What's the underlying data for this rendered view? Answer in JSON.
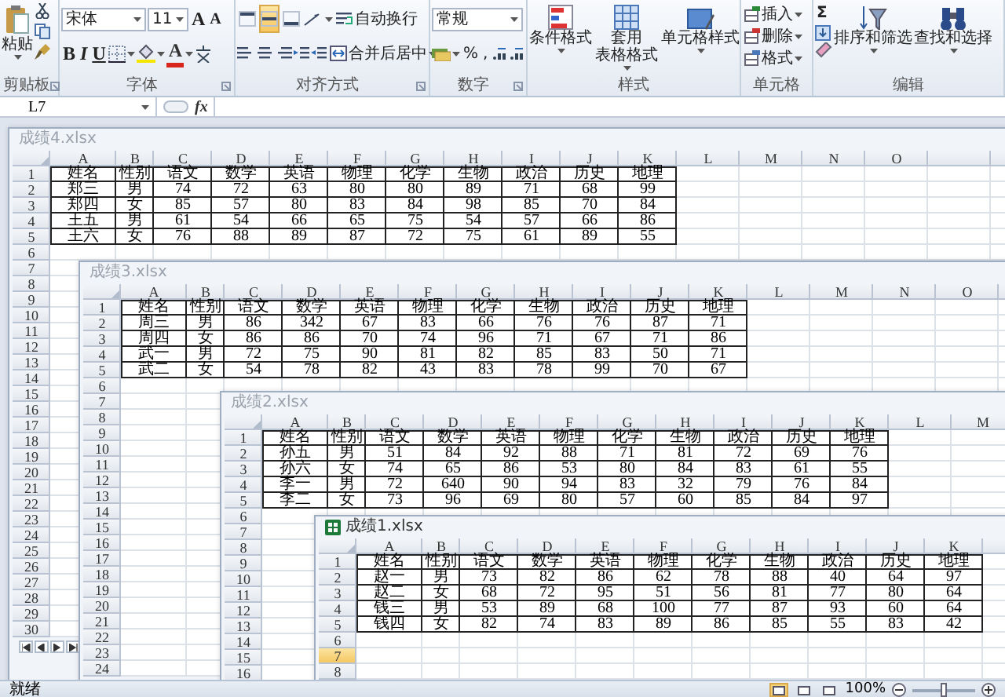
{
  "ribbon": {
    "clipboard": {
      "label": "剪贴板",
      "paste": "粘贴"
    },
    "font": {
      "label": "字体",
      "font_name": "宋体",
      "font_size": "11",
      "grow": "A",
      "shrink": "A",
      "bold": "B",
      "italic": "I",
      "underline": "U",
      "font_color": "A"
    },
    "alignment": {
      "label": "对齐方式",
      "vertical": [
        {
          "selected": false
        },
        {
          "selected": true
        },
        {
          "selected": false
        }
      ],
      "wrap": "自动换行",
      "merge": "合并后居中"
    },
    "number": {
      "label": "数字",
      "format": "常规",
      "percent": "%",
      "comma": ","
    },
    "styles": {
      "label": "样式",
      "conditional": "条件格式",
      "table": [
        "套用",
        "表格格式"
      ],
      "cell": "单元格样式"
    },
    "cells": {
      "label": "单元格",
      "insert": "插入",
      "delete": "删除",
      "format": "格式"
    },
    "editing": {
      "label": "编辑",
      "sum": "Σ",
      "sort": "排序和筛选",
      "find": "查找和选择"
    }
  },
  "formula_bar": {
    "name_box": "L7",
    "fx": "fx"
  },
  "windows": [
    {
      "title": "成绩4.xlsx",
      "active": false,
      "sheet_nav": true,
      "columns": [
        "A",
        "B",
        "C",
        "D",
        "E",
        "F",
        "G",
        "H",
        "I",
        "J",
        "K",
        "L",
        "M",
        "N",
        "O"
      ],
      "row_headers": [
        {
          "label": "1",
          "selected": false
        },
        {
          "label": "2",
          "selected": false
        },
        {
          "label": "3",
          "selected": false
        },
        {
          "label": "4",
          "selected": false
        },
        {
          "label": "5",
          "selected": false
        },
        {
          "label": "6",
          "selected": false
        },
        {
          "label": "7",
          "selected": false
        },
        {
          "label": "8",
          "selected": false
        },
        {
          "label": "9",
          "selected": false
        },
        {
          "label": "10",
          "selected": false
        },
        {
          "label": "11",
          "selected": false
        },
        {
          "label": "12",
          "selected": false
        },
        {
          "label": "13",
          "selected": false
        },
        {
          "label": "14",
          "selected": false
        },
        {
          "label": "15",
          "selected": false
        },
        {
          "label": "16",
          "selected": false
        },
        {
          "label": "17",
          "selected": false
        },
        {
          "label": "18",
          "selected": false
        },
        {
          "label": "19",
          "selected": false
        },
        {
          "label": "20",
          "selected": false
        },
        {
          "label": "21",
          "selected": false
        },
        {
          "label": "22",
          "selected": false
        },
        {
          "label": "23",
          "selected": false
        },
        {
          "label": "24",
          "selected": false
        },
        {
          "label": "25",
          "selected": false
        },
        {
          "label": "26",
          "selected": false
        },
        {
          "label": "27",
          "selected": false
        },
        {
          "label": "28",
          "selected": false
        },
        {
          "label": "29",
          "selected": false
        },
        {
          "label": "30",
          "selected": false
        }
      ],
      "rows": [
        [
          "姓名",
          "性别",
          "语文",
          "数学",
          "英语",
          "物理",
          "化学",
          "生物",
          "政治",
          "历史",
          "地理"
        ],
        [
          "郑三",
          "男",
          "74",
          "72",
          "63",
          "80",
          "80",
          "89",
          "71",
          "68",
          "99"
        ],
        [
          "郑四",
          "女",
          "85",
          "57",
          "80",
          "83",
          "84",
          "98",
          "85",
          "70",
          "84"
        ],
        [
          "王五",
          "男",
          "61",
          "54",
          "66",
          "65",
          "75",
          "54",
          "57",
          "66",
          "86"
        ],
        [
          "王六",
          "女",
          "76",
          "88",
          "89",
          "87",
          "72",
          "75",
          "61",
          "89",
          "55"
        ]
      ]
    },
    {
      "title": "成绩3.xlsx",
      "active": false,
      "sheet_nav": false,
      "columns": [
        "A",
        "B",
        "C",
        "D",
        "E",
        "F",
        "G",
        "H",
        "I",
        "J",
        "K",
        "L",
        "M",
        "N",
        "O"
      ],
      "row_headers": [
        {
          "label": "1",
          "selected": false
        },
        {
          "label": "2",
          "selected": false
        },
        {
          "label": "3",
          "selected": false
        },
        {
          "label": "4",
          "selected": false
        },
        {
          "label": "5",
          "selected": false
        },
        {
          "label": "6",
          "selected": false
        },
        {
          "label": "7",
          "selected": false
        },
        {
          "label": "8",
          "selected": false
        },
        {
          "label": "9",
          "selected": false
        },
        {
          "label": "10",
          "selected": false
        },
        {
          "label": "11",
          "selected": false
        },
        {
          "label": "12",
          "selected": false
        },
        {
          "label": "13",
          "selected": false
        },
        {
          "label": "14",
          "selected": false
        },
        {
          "label": "15",
          "selected": false
        },
        {
          "label": "16",
          "selected": false
        },
        {
          "label": "17",
          "selected": false
        },
        {
          "label": "18",
          "selected": false
        },
        {
          "label": "19",
          "selected": false
        },
        {
          "label": "20",
          "selected": false
        },
        {
          "label": "21",
          "selected": false
        },
        {
          "label": "22",
          "selected": false
        },
        {
          "label": "23",
          "selected": false
        },
        {
          "label": "24",
          "selected": false
        }
      ],
      "rows": [
        [
          "姓名",
          "性别",
          "语文",
          "数学",
          "英语",
          "物理",
          "化学",
          "生物",
          "政治",
          "历史",
          "地理"
        ],
        [
          "周三",
          "男",
          "86",
          "342",
          "67",
          "83",
          "66",
          "76",
          "76",
          "87",
          "71"
        ],
        [
          "周四",
          "女",
          "86",
          "86",
          "70",
          "74",
          "96",
          "71",
          "67",
          "71",
          "86"
        ],
        [
          "武一",
          "男",
          "72",
          "75",
          "90",
          "81",
          "82",
          "85",
          "83",
          "50",
          "71"
        ],
        [
          "武二",
          "女",
          "54",
          "78",
          "82",
          "43",
          "83",
          "78",
          "99",
          "70",
          "67"
        ]
      ]
    },
    {
      "title": "成绩2.xlsx",
      "active": false,
      "sheet_nav": false,
      "columns": [
        "A",
        "B",
        "C",
        "D",
        "E",
        "F",
        "G",
        "H",
        "I",
        "J",
        "K",
        "L",
        "M"
      ],
      "row_headers": [
        {
          "label": "1",
          "selected": false
        },
        {
          "label": "2",
          "selected": false
        },
        {
          "label": "3",
          "selected": false
        },
        {
          "label": "4",
          "selected": false
        },
        {
          "label": "5",
          "selected": false
        },
        {
          "label": "6",
          "selected": false
        },
        {
          "label": "7",
          "selected": false
        },
        {
          "label": "8",
          "selected": false
        },
        {
          "label": "9",
          "selected": false
        },
        {
          "label": "10",
          "selected": false
        },
        {
          "label": "11",
          "selected": false
        },
        {
          "label": "12",
          "selected": false
        },
        {
          "label": "13",
          "selected": false
        },
        {
          "label": "14",
          "selected": false
        },
        {
          "label": "15",
          "selected": false
        },
        {
          "label": "16",
          "selected": false
        }
      ],
      "rows": [
        [
          "姓名",
          "性别",
          "语文",
          "数学",
          "英语",
          "物理",
          "化学",
          "生物",
          "政治",
          "历史",
          "地理"
        ],
        [
          "孙五",
          "男",
          "51",
          "84",
          "92",
          "88",
          "71",
          "81",
          "72",
          "69",
          "76"
        ],
        [
          "孙六",
          "女",
          "74",
          "65",
          "86",
          "53",
          "80",
          "84",
          "83",
          "61",
          "55"
        ],
        [
          "李一",
          "男",
          "72",
          "640",
          "90",
          "94",
          "83",
          "32",
          "79",
          "76",
          "84"
        ],
        [
          "李二",
          "女",
          "73",
          "96",
          "69",
          "80",
          "57",
          "60",
          "85",
          "84",
          "97"
        ]
      ]
    },
    {
      "title": "成绩1.xlsx",
      "active": true,
      "sheet_nav": false,
      "columns": [
        "A",
        "B",
        "C",
        "D",
        "E",
        "F",
        "G",
        "H",
        "I",
        "J",
        "K"
      ],
      "row_headers": [
        {
          "label": "1",
          "selected": false
        },
        {
          "label": "2",
          "selected": false
        },
        {
          "label": "3",
          "selected": false
        },
        {
          "label": "4",
          "selected": false
        },
        {
          "label": "5",
          "selected": false
        },
        {
          "label": "6",
          "selected": false
        },
        {
          "label": "7",
          "selected": true
        },
        {
          "label": "8",
          "selected": false
        }
      ],
      "rows": [
        [
          "姓名",
          "性别",
          "语文",
          "数学",
          "英语",
          "物理",
          "化学",
          "生物",
          "政治",
          "历史",
          "地理"
        ],
        [
          "赵一",
          "男",
          "73",
          "82",
          "86",
          "62",
          "78",
          "88",
          "40",
          "64",
          "97"
        ],
        [
          "赵二",
          "女",
          "68",
          "72",
          "95",
          "51",
          "56",
          "81",
          "77",
          "80",
          "64"
        ],
        [
          "钱三",
          "男",
          "53",
          "89",
          "68",
          "100",
          "77",
          "87",
          "93",
          "60",
          "64"
        ],
        [
          "钱四",
          "女",
          "82",
          "74",
          "83",
          "89",
          "86",
          "85",
          "55",
          "83",
          "42"
        ]
      ]
    }
  ],
  "status_bar": {
    "status": "就绪",
    "views": [
      {
        "selected": true
      },
      {
        "selected": false
      },
      {
        "selected": false
      }
    ],
    "zoom": "100%",
    "zoom_slider": {
      "level": 0.5
    }
  }
}
